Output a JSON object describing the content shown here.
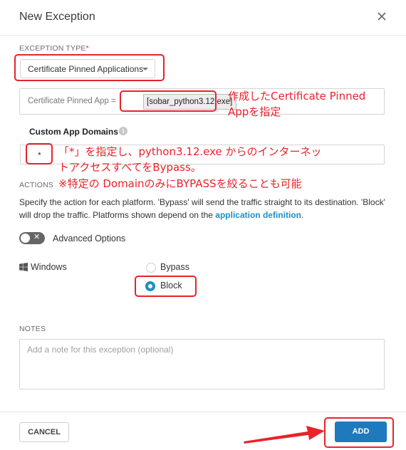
{
  "dialog": {
    "title": "New Exception",
    "close_icon": "close-icon"
  },
  "exception_type": {
    "label": "EXCEPTION TYPE",
    "required_mark": "*",
    "selected": "Certificate Pinned Applications"
  },
  "app": {
    "label": "Certificate Pinned App =",
    "value": "[sobar_python3.12.exe]"
  },
  "custom_domains": {
    "label": "Custom App Domains",
    "info_icon": "info-icon",
    "value": "*"
  },
  "actions": {
    "label": "ACTIONS",
    "description": "Specify the action for each platform. 'Bypass' will send the traffic straight to its destination. 'Block' will drop the traffic. Platforms shown depend on the",
    "link": "application definition",
    "description_end": "."
  },
  "advanced": {
    "label": "Advanced Options",
    "toggle_mark": "✕",
    "enabled": false
  },
  "platform": {
    "name": "Windows",
    "icon": "windows-icon",
    "options": [
      {
        "label": "Bypass",
        "selected": false
      },
      {
        "label": "Block",
        "selected": true
      }
    ]
  },
  "notes": {
    "label": "NOTES",
    "placeholder": "Add a note for this exception (optional)"
  },
  "footer": {
    "cancel": "CANCEL",
    "add": "ADD"
  },
  "annotations": {
    "app_note_line1": "作成したCertificate Pinned",
    "app_note_line2": "Appを指定",
    "domain_note_line1": "「*」を指定し、python3.12.exe からのインターネッ",
    "domain_note_line2": "トアクセスすべてをBypass。",
    "domain_note_line3": "※特定の DomainのみにBYPASSを絞ることも可能"
  },
  "colors": {
    "accent": "#1f8ec2",
    "primary_button": "#1f79bd",
    "annotation_red": "#e8232a",
    "required_red": "#e0301e"
  }
}
